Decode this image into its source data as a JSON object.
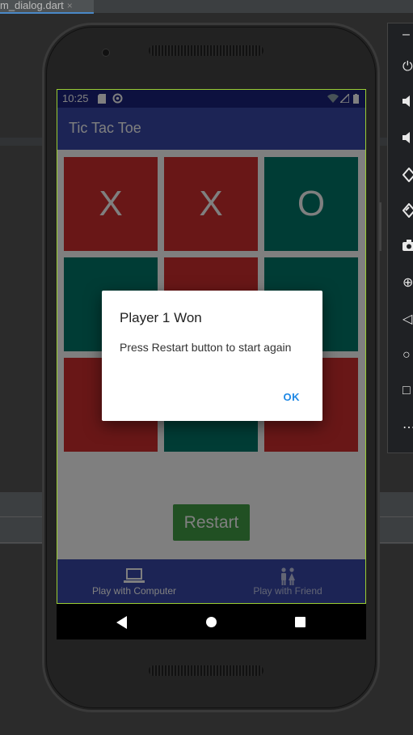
{
  "ide": {
    "tab_label": "m_dialog.dart",
    "tab_close": "×"
  },
  "emulator_toolbar": {
    "items": [
      {
        "icon": "minimize-icon",
        "glyph": "–"
      },
      {
        "icon": "power-icon",
        "glyph": "⏻"
      },
      {
        "icon": "volume-up-icon",
        "glyph": "🔊"
      },
      {
        "icon": "volume-down-icon",
        "glyph": "🔉"
      },
      {
        "icon": "rotate-left-icon",
        "glyph": "◇"
      },
      {
        "icon": "rotate-right-icon",
        "glyph": "◈"
      },
      {
        "icon": "camera-icon",
        "glyph": "📷"
      },
      {
        "icon": "zoom-icon",
        "glyph": "⊕"
      },
      {
        "icon": "back-icon",
        "glyph": "◁"
      },
      {
        "icon": "home-icon",
        "glyph": "○"
      },
      {
        "icon": "overview-icon",
        "glyph": "□"
      },
      {
        "icon": "more-icon",
        "glyph": "⋯"
      }
    ]
  },
  "status_bar": {
    "time": "10:25"
  },
  "app_bar": {
    "title": "Tic Tac Toe"
  },
  "board": {
    "cells": [
      {
        "mark": "X",
        "color": "red"
      },
      {
        "mark": "X",
        "color": "red"
      },
      {
        "mark": "O",
        "color": "green"
      },
      {
        "mark": "",
        "color": "green"
      },
      {
        "mark": "",
        "color": "red"
      },
      {
        "mark": "",
        "color": "green"
      },
      {
        "mark": "",
        "color": "red"
      },
      {
        "mark": "",
        "color": "green"
      },
      {
        "mark": "",
        "color": "red"
      }
    ]
  },
  "restart_label": "Restart",
  "bottom_nav": {
    "items": [
      {
        "label": "Play with Computer",
        "icon": "laptop-icon",
        "active": true
      },
      {
        "label": "Play with Friend",
        "icon": "people-icon",
        "active": false
      }
    ]
  },
  "dialog": {
    "title": "Player 1 Won",
    "body": "Press Restart button to start again",
    "ok_label": "OK"
  },
  "colors": {
    "primary": "#3949ab",
    "status_bar": "#1a237e",
    "cell_red": "#d32f2f",
    "cell_green": "#00796b",
    "restart_green": "#43a047",
    "dialog_action": "#1e88e5"
  }
}
